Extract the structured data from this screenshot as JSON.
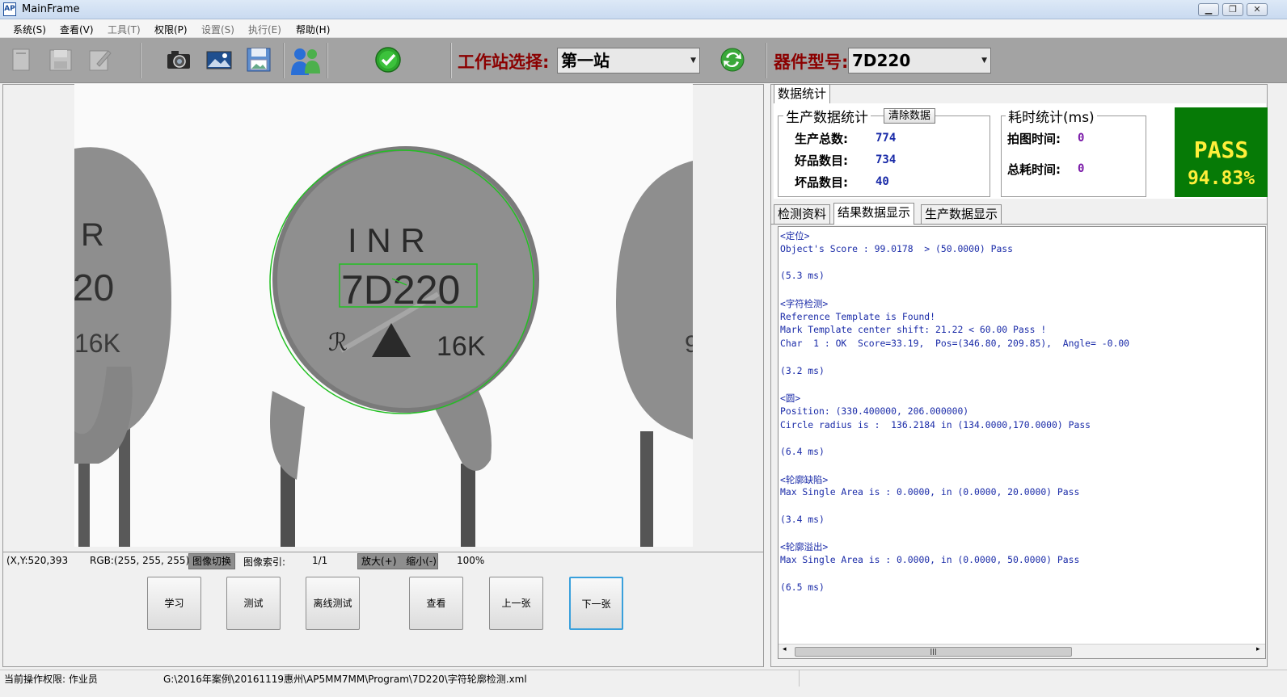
{
  "window": {
    "title": "MainFrame",
    "app_icon_text": "AP",
    "controls": [
      "minimize",
      "restore",
      "close"
    ]
  },
  "menu": {
    "items": [
      {
        "label": "系统(S)",
        "enabled": true
      },
      {
        "label": "查看(V)",
        "enabled": true
      },
      {
        "label": "工具(T)",
        "enabled": false
      },
      {
        "label": "权限(P)",
        "enabled": true
      },
      {
        "label": "设置(S)",
        "enabled": false
      },
      {
        "label": "执行(E)",
        "enabled": false
      },
      {
        "label": "帮助(H)",
        "enabled": true
      }
    ]
  },
  "toolbar": {
    "icons": [
      "new-icon",
      "save-icon",
      "edit-icon",
      "camera-icon",
      "image-icon",
      "save-image-icon",
      "users-icon",
      "check-icon",
      "refresh-icon"
    ],
    "station_label": "工作站选择:",
    "station_value": "第一站",
    "part_label": "器件型号:",
    "part_value": "7D220"
  },
  "image_view": {
    "center_part": {
      "line1": "I N R",
      "line2": "7D220",
      "line3": "16K"
    },
    "left_part": {
      "line1": "R",
      "line2": "20",
      "line3": "16K"
    },
    "right_part": {
      "line3": "9"
    },
    "overlay_color": "#22c022"
  },
  "status_row": {
    "coords": "(X,Y:520,393",
    "rgb": "RGB:(255, 255, 255)",
    "switch_label": "图像切换",
    "index_label": "图像索引:",
    "index_value": "1/1",
    "zoom_in": "放大(+)",
    "zoom_out": "缩小(-)",
    "zoom_value": "100%"
  },
  "actions": {
    "learn": "学习",
    "test": "测试",
    "offline_test": "离线测试",
    "view": "查看",
    "prev": "上一张",
    "next": "下一张"
  },
  "stats": {
    "tab": "数据统计",
    "production": {
      "title": "生产数据统计",
      "clear_button": "清除数据",
      "total_label": "生产总数:",
      "total_value": "774",
      "good_label": "好品数目:",
      "good_value": "734",
      "bad_label": "坏品数目:",
      "bad_value": "40"
    },
    "timing": {
      "title": "耗时统计(ms)",
      "capture_label": "拍图时间:",
      "capture_value": "0",
      "total_label": "总耗时间:",
      "total_value": "0"
    },
    "result": {
      "status": "PASS",
      "rate": "94.83%"
    },
    "colors": {
      "pass_bg": "#067a06",
      "pass_text": "#ffef3a"
    }
  },
  "results": {
    "tabs": [
      "检测资料",
      "结果数据显示",
      "生产数据显示"
    ],
    "active_tab": "结果数据显示",
    "lines": [
      "<定位>",
      "Object's Score : 99.0178  > (50.0000) Pass",
      "",
      "(5.3 ms)",
      "",
      "<字符检测>",
      "Reference Template is Found!",
      "Mark Template center shift: 21.22 < 60.00 Pass !",
      "Char  1 : OK  Score=33.19,  Pos=(346.80, 209.85),  Angle= -0.00",
      "",
      "(3.2 ms)",
      "",
      "<圆>",
      "Position: (330.400000, 206.000000)",
      "Circle radius is :  136.2184 in (134.0000,170.0000) Pass",
      "",
      "(6.4 ms)",
      "",
      "<轮廓缺陷>",
      "Max Single Area is : 0.0000, in (0.0000, 20.0000) Pass",
      "",
      "(3.4 ms)",
      "",
      "<轮廓溢出>",
      "Max Single Area is : 0.0000, in (0.0000, 50.0000) Pass",
      "",
      "(6.5 ms)"
    ]
  },
  "statusbar": {
    "permission": "当前操作权限:  作业员",
    "path": "G:\\2016年案例\\20161119惠州\\AP5MM7MM\\Program\\7D220\\字符轮廓检测.xml"
  }
}
